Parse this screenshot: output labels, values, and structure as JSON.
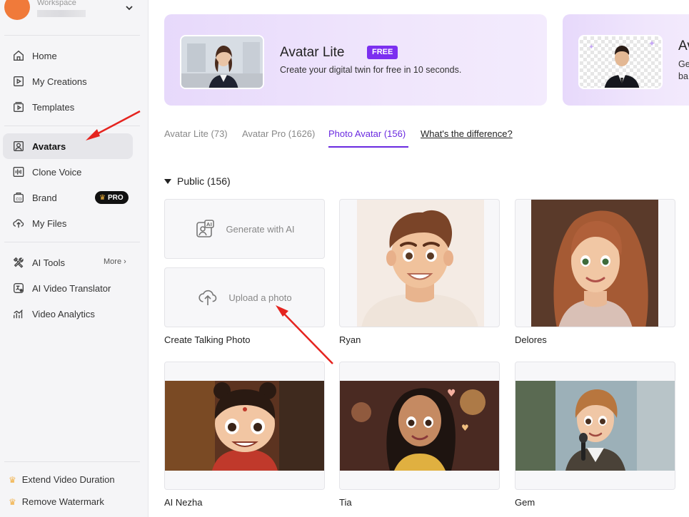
{
  "workspace": {
    "label": "Workspace"
  },
  "sidebar": {
    "items": [
      {
        "label": "Home"
      },
      {
        "label": "My Creations"
      },
      {
        "label": "Templates"
      },
      {
        "label": "Avatars"
      },
      {
        "label": "Clone Voice"
      },
      {
        "label": "Brand",
        "badge": "PRO"
      },
      {
        "label": "My Files"
      },
      {
        "label": "AI Tools",
        "more": "More"
      },
      {
        "label": "AI Video Translator"
      },
      {
        "label": "Video Analytics"
      }
    ],
    "bottom": [
      {
        "label": "Extend Video Duration"
      },
      {
        "label": "Remove Watermark"
      }
    ]
  },
  "banner": {
    "title": "Avatar Lite",
    "badge": "FREE",
    "subtitle": "Create your digital twin for free in 10 seconds."
  },
  "banner2": {
    "title": "Av",
    "subtitle_line1": "Ge",
    "subtitle_line2": "ba"
  },
  "tabs": [
    {
      "label": "Avatar Lite (73)"
    },
    {
      "label": "Avatar Pro (1626)"
    },
    {
      "label": "Photo Avatar (156)"
    },
    {
      "label": "What's the difference?"
    }
  ],
  "section": {
    "title": "Public (156)"
  },
  "actions": {
    "generate": "Generate with AI",
    "upload": "Upload a photo",
    "label": "Create Talking Photo"
  },
  "avatars": [
    {
      "name": "Ryan"
    },
    {
      "name": "Delores"
    },
    {
      "name": "AI Nezha"
    },
    {
      "name": "Tia"
    },
    {
      "name": "Gem"
    }
  ],
  "colors": {
    "accent": "#6a2ae0",
    "free_badge": "#7c2ff0",
    "annotation_arrow": "#e5241f"
  }
}
